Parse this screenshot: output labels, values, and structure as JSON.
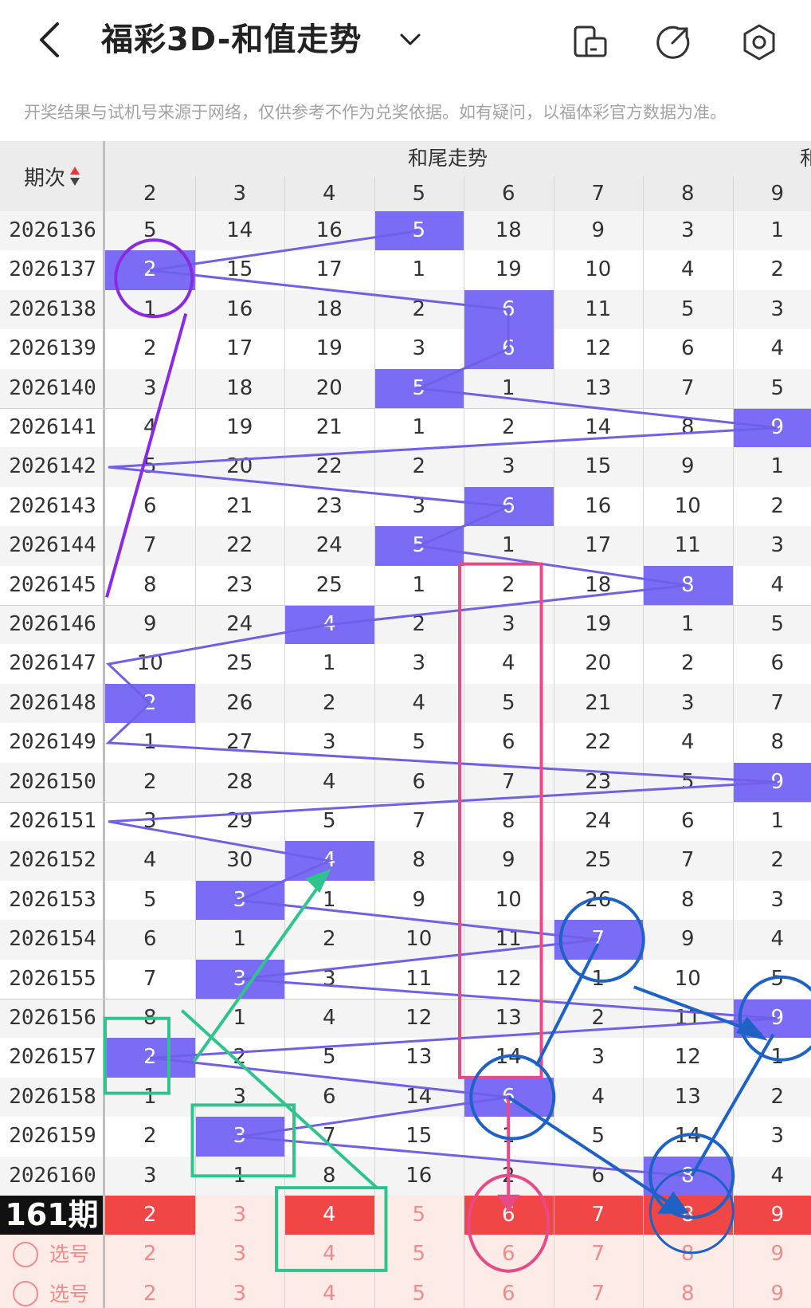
{
  "header": {
    "title": "福彩3D-和值走势",
    "back_icon": "back-chevron-icon",
    "dropdown_icon": "chevron-down-icon",
    "actions": [
      "device-layout-icon",
      "share-icon",
      "settings-hex-icon"
    ]
  },
  "disclaimer": "开奖结果与试机号来源于网络，仅供参考不作为兑奖依据。如有疑问，以福体彩官方数据为准。",
  "table": {
    "period_header": "期次",
    "group_header": "和尾走势",
    "next_group_partial": "和",
    "columns": [
      "2",
      "3",
      "4",
      "5",
      "6",
      "7",
      "8",
      "9"
    ],
    "rows": [
      {
        "period": "2026136",
        "cells": [
          "5",
          "14",
          "16",
          "5",
          "18",
          "9",
          "3",
          "1"
        ],
        "hit": 3
      },
      {
        "period": "2026137",
        "cells": [
          "2",
          "15",
          "17",
          "1",
          "19",
          "10",
          "4",
          "2"
        ],
        "hit": 0
      },
      {
        "period": "2026138",
        "cells": [
          "1",
          "16",
          "18",
          "2",
          "6",
          "11",
          "5",
          "3"
        ],
        "hit": 4
      },
      {
        "period": "2026139",
        "cells": [
          "2",
          "17",
          "19",
          "3",
          "6",
          "12",
          "6",
          "4"
        ],
        "hit": 4
      },
      {
        "period": "2026140",
        "cells": [
          "3",
          "18",
          "20",
          "5",
          "1",
          "13",
          "7",
          "5"
        ],
        "hit": 3
      },
      {
        "period": "2026141",
        "cells": [
          "4",
          "19",
          "21",
          "1",
          "2",
          "14",
          "8",
          "9"
        ],
        "hit": 7
      },
      {
        "period": "2026142",
        "cells": [
          "5",
          "20",
          "22",
          "2",
          "3",
          "15",
          "9",
          "1"
        ],
        "hit": -1
      },
      {
        "period": "2026143",
        "cells": [
          "6",
          "21",
          "23",
          "3",
          "6",
          "16",
          "10",
          "2"
        ],
        "hit": 4
      },
      {
        "period": "2026144",
        "cells": [
          "7",
          "22",
          "24",
          "5",
          "1",
          "17",
          "11",
          "3"
        ],
        "hit": 3
      },
      {
        "period": "2026145",
        "cells": [
          "8",
          "23",
          "25",
          "1",
          "2",
          "18",
          "8",
          "4"
        ],
        "hit": 6
      },
      {
        "period": "2026146",
        "cells": [
          "9",
          "24",
          "4",
          "2",
          "3",
          "19",
          "1",
          "5"
        ],
        "hit": 2
      },
      {
        "period": "2026147",
        "cells": [
          "10",
          "25",
          "1",
          "3",
          "4",
          "20",
          "2",
          "6"
        ],
        "hit": -1
      },
      {
        "period": "2026148",
        "cells": [
          "2",
          "26",
          "2",
          "4",
          "5",
          "21",
          "3",
          "7"
        ],
        "hit": 0
      },
      {
        "period": "2026149",
        "cells": [
          "1",
          "27",
          "3",
          "5",
          "6",
          "22",
          "4",
          "8"
        ],
        "hit": -1
      },
      {
        "period": "2026150",
        "cells": [
          "2",
          "28",
          "4",
          "6",
          "7",
          "23",
          "5",
          "9"
        ],
        "hit": 7
      },
      {
        "period": "2026151",
        "cells": [
          "3",
          "29",
          "5",
          "7",
          "8",
          "24",
          "6",
          "1"
        ],
        "hit": -1
      },
      {
        "period": "2026152",
        "cells": [
          "4",
          "30",
          "4",
          "8",
          "9",
          "25",
          "7",
          "2"
        ],
        "hit": 2
      },
      {
        "period": "2026153",
        "cells": [
          "5",
          "3",
          "1",
          "9",
          "10",
          "26",
          "8",
          "3"
        ],
        "hit": 1
      },
      {
        "period": "2026154",
        "cells": [
          "6",
          "1",
          "2",
          "10",
          "11",
          "7",
          "9",
          "4"
        ],
        "hit": 5
      },
      {
        "period": "2026155",
        "cells": [
          "7",
          "3",
          "3",
          "11",
          "12",
          "1",
          "10",
          "5"
        ],
        "hit": 1
      },
      {
        "period": "2026156",
        "cells": [
          "8",
          "1",
          "4",
          "12",
          "13",
          "2",
          "11",
          "9"
        ],
        "hit": 7
      },
      {
        "period": "2026157",
        "cells": [
          "2",
          "2",
          "5",
          "13",
          "14",
          "3",
          "12",
          "1"
        ],
        "hit": 0
      },
      {
        "period": "2026158",
        "cells": [
          "1",
          "3",
          "6",
          "14",
          "6",
          "4",
          "13",
          "2"
        ],
        "hit": 4
      },
      {
        "period": "2026159",
        "cells": [
          "2",
          "3",
          "7",
          "15",
          "1",
          "5",
          "14",
          "3"
        ],
        "hit": 1
      },
      {
        "period": "2026160",
        "cells": [
          "3",
          "1",
          "8",
          "16",
          "2",
          "6",
          "8",
          "4"
        ],
        "hit": 6
      }
    ],
    "prediction_row": {
      "label": "161期",
      "cells": [
        "2",
        "3",
        "4",
        "5",
        "6",
        "7",
        "8",
        "9"
      ],
      "red_hits": [
        0,
        2,
        4,
        5,
        6,
        7
      ]
    },
    "pick_rows": [
      {
        "label": "选号",
        "cells": [
          "2",
          "3",
          "4",
          "5",
          "6",
          "7",
          "8",
          "9"
        ]
      },
      {
        "label": "选号",
        "cells": [
          "2",
          "3",
          "4",
          "5",
          "6",
          "7",
          "8",
          "9"
        ]
      }
    ]
  },
  "colors": {
    "hit": "#7b6cf6",
    "line": "#7060e8",
    "red": "#f04646",
    "pink": "#e84a88",
    "green": "#2fc48e",
    "blue": "#1d62c4",
    "purple": "#8a2be2"
  }
}
